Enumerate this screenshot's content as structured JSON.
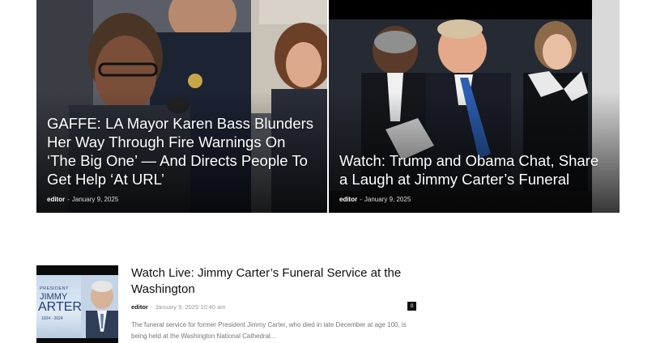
{
  "featured": [
    {
      "title": "GAFFE: LA Mayor Karen Bass Blunders Her Way Through Fire Warnings On ‘The Big One’ — And Directs People To Get Help ‘At URL’",
      "author": "editor",
      "separator": "-",
      "date": "January 9, 2025"
    },
    {
      "title": "Watch: Trump and Obama Chat, Share a Laugh at Jimmy Carter’s Funeral",
      "author": "editor",
      "separator": "-",
      "date": "January 9, 2025"
    }
  ],
  "latest": {
    "title": "Watch Live: Jimmy Carter’s Funeral Service at the Washington",
    "author": "editor",
    "separator": "-",
    "datetime": "January 9, 2025 10:40 am",
    "comments": "0",
    "excerpt": "The funeral service for former President Jimmy Carter, who died in late December at age 100, is being held at the Washington National Cathedral...",
    "thumbnail": {
      "kicker": "PRESIDENT",
      "name_line1": "JIMMY",
      "name_line2": "ARTER",
      "years": "1924 - 2024"
    }
  },
  "colors": {
    "accent_dark": "#111111",
    "meta_grey": "#999999",
    "excerpt_grey": "#767676"
  }
}
